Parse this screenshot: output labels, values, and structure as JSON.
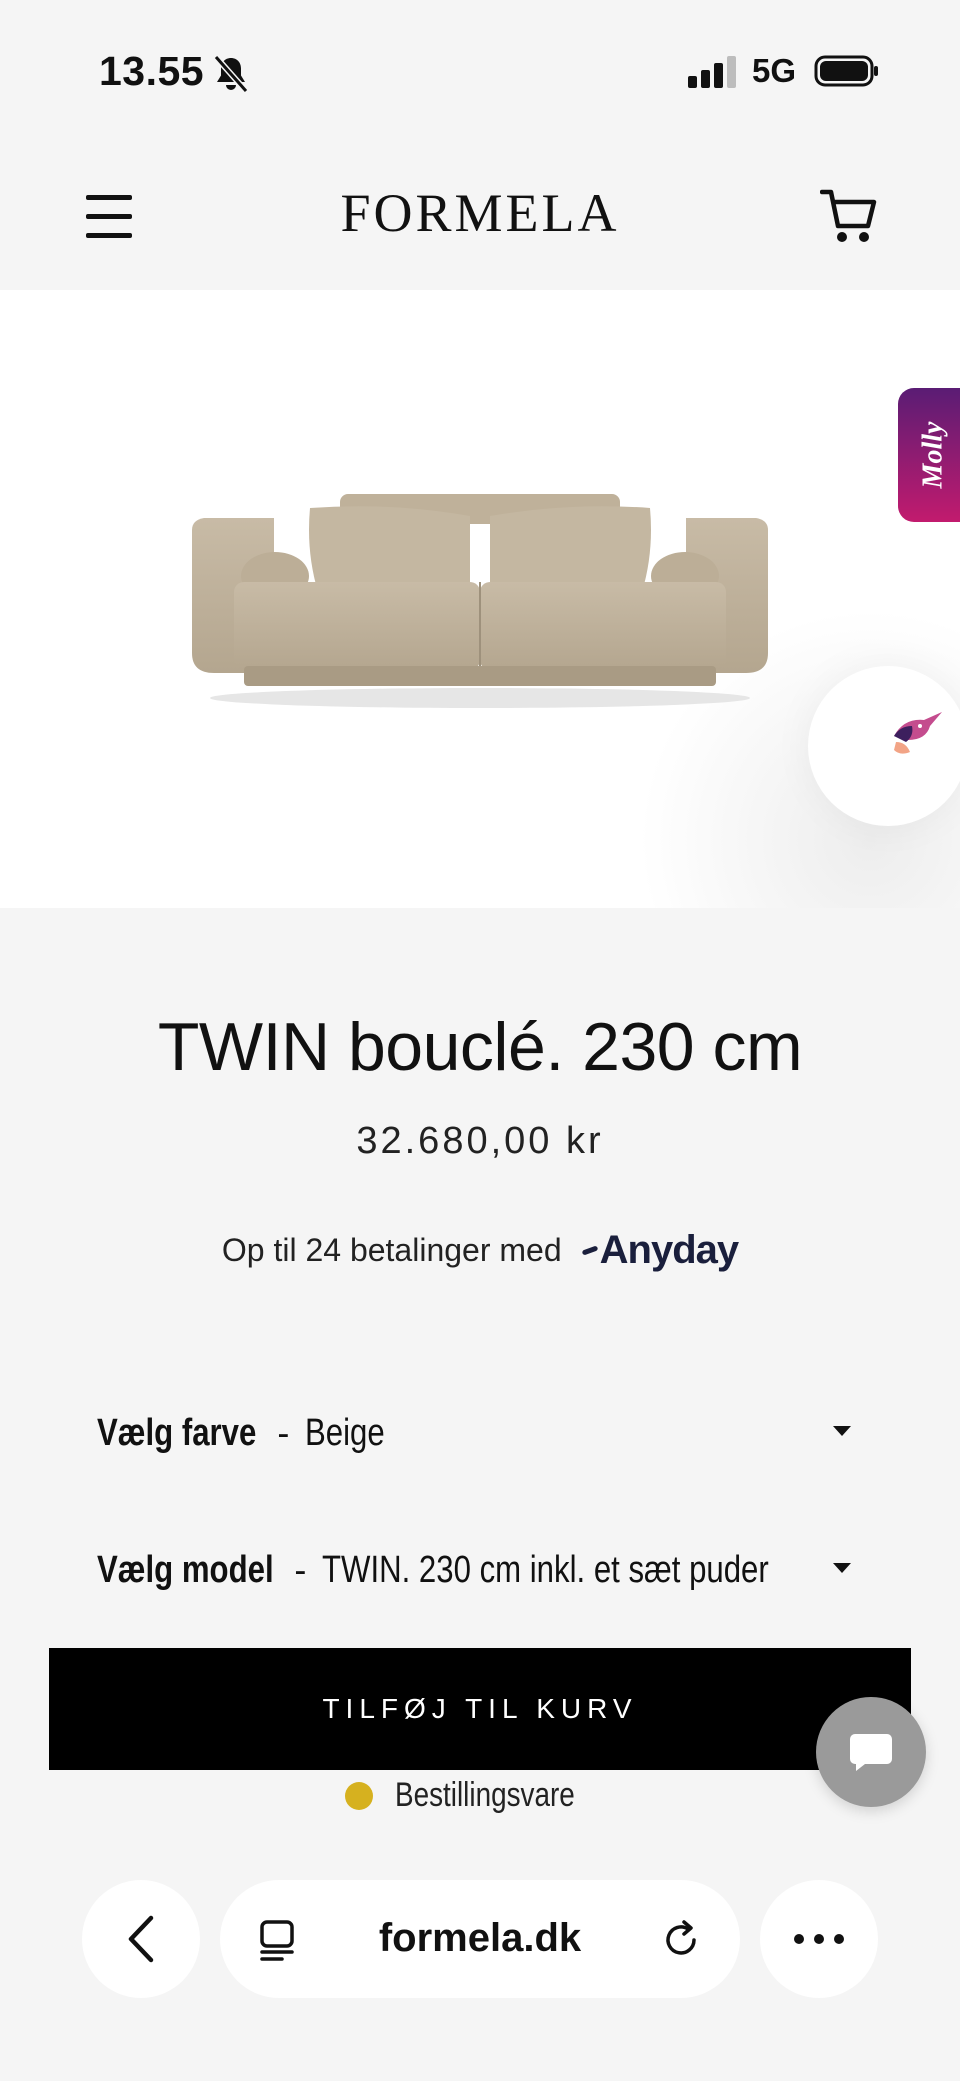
{
  "status_bar": {
    "time": "13.55",
    "network": "5G"
  },
  "header": {
    "logo": "FORMELA",
    "menu_icon": "hamburger-menu-icon",
    "cart_icon": "shopping-cart-icon"
  },
  "hero": {
    "image": "sofa-product-image",
    "side_widget": "Molly",
    "side_widget_color": "#8b1a72"
  },
  "product": {
    "title": "TWIN bouclé. 230 cm",
    "price": "32.680,00 kr",
    "installments_text": "Op til 24 betalinger med",
    "installments_provider": "Anyday"
  },
  "options": {
    "color_label": "Vælg farve",
    "color_separator": "-",
    "color_value": "Beige",
    "model_label": "Vælg model",
    "model_separator": "-",
    "model_value": "TWIN. 230 cm inkl. et sæt puder"
  },
  "cta": {
    "add_to_cart": "TILFØJ TIL KURV"
  },
  "stock": {
    "status": "Bestillingsvare",
    "color": "#d6b11f"
  },
  "browser": {
    "url": "formela.dk"
  }
}
